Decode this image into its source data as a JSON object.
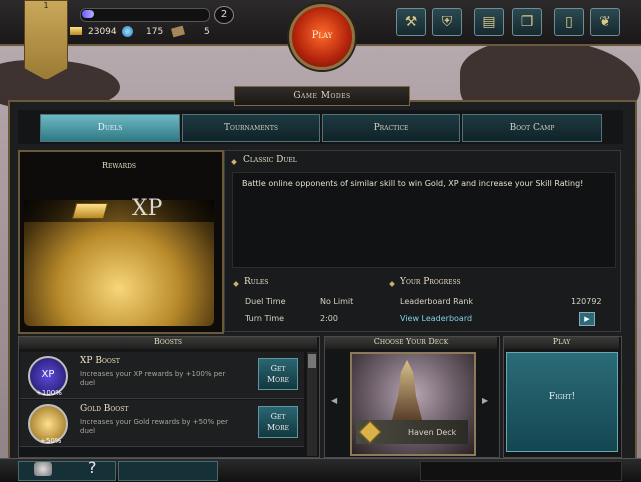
{
  "topbar": {
    "level_badge": "1",
    "xp_progress": 0.1,
    "level": "2",
    "gold": "23094",
    "gems": "175",
    "tickets": "5",
    "play_label": "Play",
    "buttons": [
      "hammer-icon",
      "shield-icon",
      "chest-icon",
      "cards-icon",
      "question-card-icon",
      "laurel-icon"
    ]
  },
  "panel": {
    "title": "Game Modes",
    "tabs": [
      {
        "label": "Duels",
        "active": true
      },
      {
        "label": "Tournaments",
        "active": false
      },
      {
        "label": "Practice",
        "active": false
      },
      {
        "label": "Boot Camp",
        "active": false
      }
    ]
  },
  "rewards": {
    "title": "Rewards",
    "xp_label": "XP"
  },
  "duel": {
    "title": "Classic Duel",
    "description": "Battle online opponents of similar skill to win Gold, XP and increase your Skill Rating!",
    "rules_title": "Rules",
    "rules": [
      {
        "label": "Duel Time",
        "value": "No Limit"
      },
      {
        "label": "Turn Time",
        "value": "2:00"
      }
    ],
    "progress_title": "Your Progress",
    "leaderboard_rank_label": "Leaderboard Rank",
    "leaderboard_rank_value": "120792",
    "view_leaderboard": "View Leaderboard",
    "go_arrow": "▶"
  },
  "boosts": {
    "title": "Boosts",
    "items": [
      {
        "name": "XP Boost",
        "icon_text": "XP",
        "percent": "+100%",
        "description": "Increases your XP rewards by +100% per duel",
        "button": "Get More"
      },
      {
        "name": "Gold Boost",
        "icon_text": "",
        "percent": "+50%",
        "description": "Increases your Gold rewards by +50% per duel",
        "button": "Get More"
      }
    ]
  },
  "deck": {
    "title": "Choose Your Deck",
    "name": "Haven Deck",
    "prev": "◀",
    "next": "▶"
  },
  "play": {
    "title": "Play",
    "fight_label": "Fight!"
  },
  "footer": {
    "help": "?"
  }
}
